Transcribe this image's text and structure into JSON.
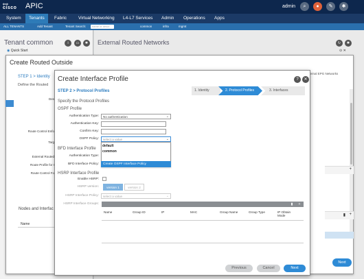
{
  "header": {
    "brand": "cisco",
    "app_title": "APIC",
    "user": "admin",
    "icons": [
      "search-icon",
      "bell-icon",
      "wrench-icon",
      "gear-icon"
    ]
  },
  "nav": {
    "items": [
      "System",
      "Tenants",
      "Fabric",
      "Virtual Networking",
      "L4-L7 Services",
      "Admin",
      "Operations",
      "Apps"
    ],
    "active": "Tenants"
  },
  "subnav": {
    "all_tenants": "ALL TENANTS",
    "add_tenant": "Add Tenant",
    "tenant_search": "Tenant Search:",
    "search_placeholder": "name or descr",
    "common": "common",
    "infra": "infra",
    "mgmt": "mgmt"
  },
  "left_pane": {
    "title": "Tenant common",
    "quick_start": "Quick Start",
    "nodes_label": "Nodes and Interfac",
    "name_header": "Name"
  },
  "right_pane": {
    "title": "External Routed Networks"
  },
  "routed_outside": {
    "title": "Create Routed Outside",
    "step": "STEP 1 > Identity",
    "define": "Define the Routed",
    "labels": [
      "Des",
      "Route Control Enfo",
      "Targ",
      "External Routed",
      "Route Profile for I",
      "Route Control Fo"
    ],
    "tab_text": "External EPG Networks",
    "next_label": "Next"
  },
  "interface_profile": {
    "title": "Create Interface Profile",
    "step": "STEP 2 > Protocol Profiles",
    "specify": "Specify the Protocol Profiles",
    "wizard": [
      "1. Identity",
      "2. Protocol Profiles",
      "3. Interfaces"
    ],
    "ospf": {
      "section": "OSPF Profile",
      "auth_type_label": "Authentication Type:",
      "auth_type_value": "No authentication",
      "auth_key_label": "Authentication Key:",
      "confirm_key_label": "Confirm Key:",
      "policy_label": "OSPF Policy:",
      "policy_placeholder": "select a value",
      "options": [
        "default",
        "common"
      ],
      "create_option": "Create OSPF Interface Policy"
    },
    "bfd": {
      "section": "BFD Interface Profile",
      "auth_type_label": "Authentication Type:",
      "policy_label": "BFD Interface Policy:"
    },
    "hsrp": {
      "section": "HSRP Interface Profile",
      "enable_label": "Enable HSRP:",
      "version_label": "HSRP version:",
      "versions": [
        "version 1",
        "version 2"
      ],
      "policy_label": "HSRP Interface Policy:",
      "policy_placeholder": "select a value",
      "groups_label": "HSRP Interface Groups:"
    },
    "table": {
      "columns": [
        "Name",
        "Group ID",
        "IP",
        "MAC",
        "Group Name",
        "Group Type",
        "IP Obtain Mode"
      ]
    },
    "buttons": {
      "previous": "Previous",
      "cancel": "Cancel",
      "next": "Next"
    }
  },
  "colors": {
    "header_bg": "#0d274d",
    "nav_bg": "#1b3a66",
    "accent": "#2e8bd6",
    "subnav_bg": "#2a6fad"
  }
}
